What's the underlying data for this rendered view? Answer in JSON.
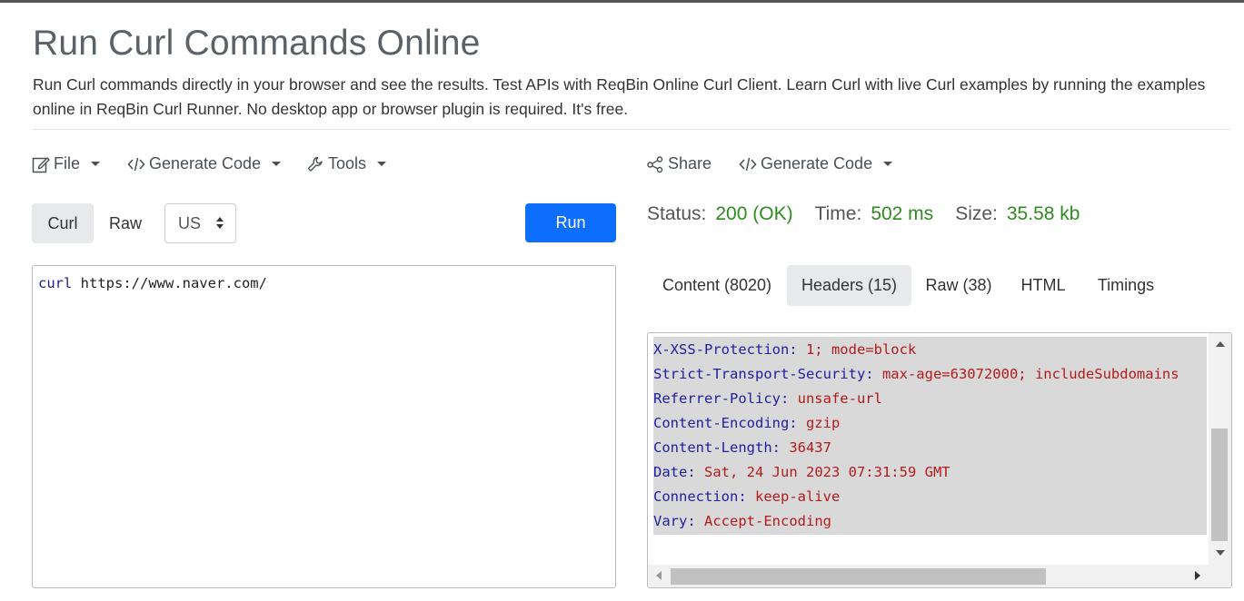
{
  "page": {
    "title": "Run Curl Commands Online",
    "description": "Run Curl commands directly in your browser and see the results. Test APIs with ReqBin Online Curl Client. Learn Curl with live Curl examples by running the examples online in ReqBin Curl Runner. No desktop app or browser plugin is required. It's free."
  },
  "left_toolbar": {
    "file_label": "File",
    "generate_code_label": "Generate Code",
    "tools_label": "Tools"
  },
  "request": {
    "tabs": [
      {
        "label": "Curl",
        "active": true
      },
      {
        "label": "Raw",
        "active": false
      }
    ],
    "region_selected": "US",
    "run_label": "Run",
    "command_keyword": "curl",
    "command_url": " https://www.naver.com/"
  },
  "right_toolbar": {
    "share_label": "Share",
    "generate_code_label": "Generate Code"
  },
  "response": {
    "status_label": "Status:",
    "status_value": "200 (OK)",
    "time_label": "Time:",
    "time_value": "502 ms",
    "size_label": "Size:",
    "size_value": "35.58 kb",
    "tabs": [
      {
        "label": "Content (8020)",
        "active": false
      },
      {
        "label": "Headers (15)",
        "active": true
      },
      {
        "label": "Raw (38)",
        "active": false
      },
      {
        "label": "HTML",
        "active": false
      },
      {
        "label": "Timings",
        "active": false
      }
    ],
    "headers": [
      {
        "key": "X-XSS-Protection:",
        "value": " 1; mode=block"
      },
      {
        "key": "Strict-Transport-Security:",
        "value": " max-age=63072000; includeSubdomains"
      },
      {
        "key": "Referrer-Policy:",
        "value": " unsafe-url"
      },
      {
        "key": "Content-Encoding:",
        "value": " gzip"
      },
      {
        "key": "Content-Length:",
        "value": " 36437"
      },
      {
        "key": "Date:",
        "value": " Sat, 24 Jun 2023 07:31:59 GMT"
      },
      {
        "key": "Connection:",
        "value": " keep-alive"
      },
      {
        "key": "Vary:",
        "value": " Accept-Encoding"
      }
    ]
  },
  "colors": {
    "run_button": "#0d6efd",
    "status_value": "#2e8b1e",
    "header_key": "#2020a0",
    "header_value": "#b31b1b"
  }
}
